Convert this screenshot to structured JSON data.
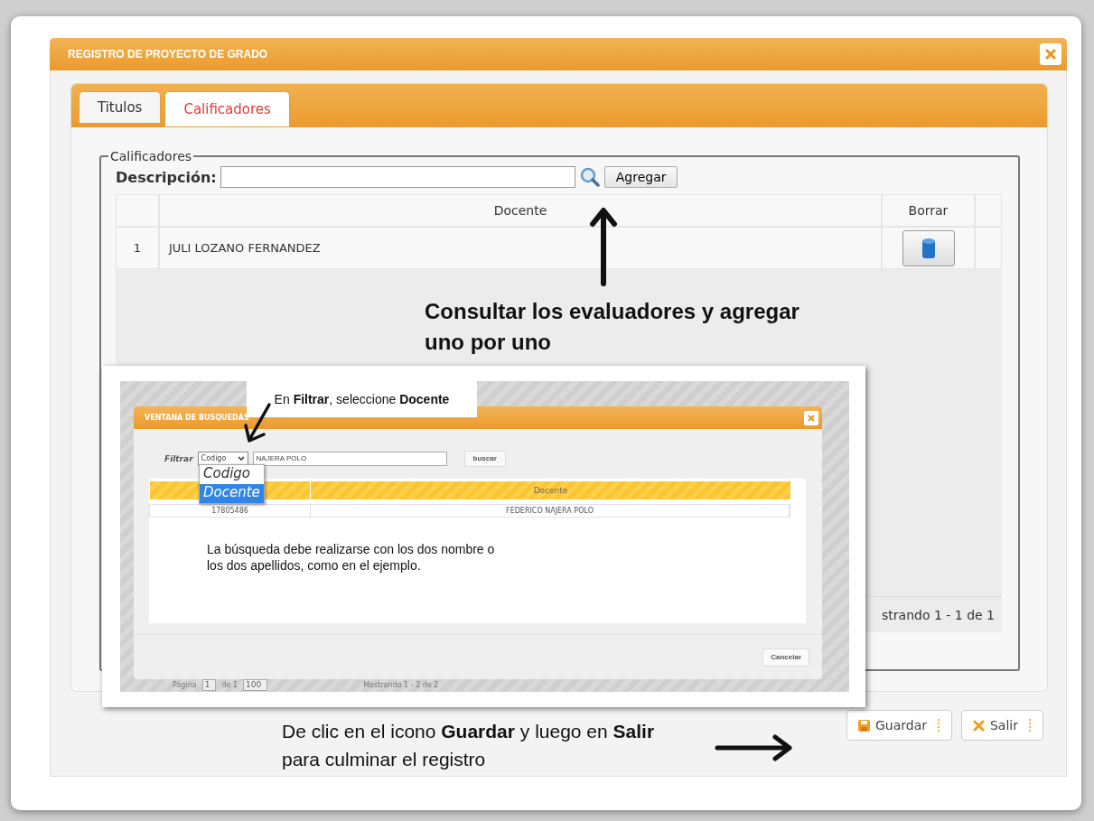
{
  "dialog": {
    "title": "REGISTRO DE PROYECTO DE GRADO"
  },
  "tabs": [
    {
      "label": "Titulos",
      "selected": false
    },
    {
      "label": "Calificadores",
      "selected": true
    }
  ],
  "fieldset": {
    "legend": "Calificadores",
    "search_label": "Descripción:",
    "add_button": "Agregar",
    "columns": [
      "Docente",
      "Borrar"
    ],
    "rows": [
      {
        "index": "1",
        "docente": "JULI LOZANO FERNANDEZ"
      }
    ],
    "pager": "strando 1 - 1 de 1"
  },
  "buttons": [
    {
      "kind": "save",
      "label": "Guardar"
    },
    {
      "kind": "exit",
      "label": "Salir"
    }
  ],
  "annotations": {
    "search": "Consultar los evaluadores y agregar uno por uno",
    "callout": "En **Filtrar**, seleccione **Docente**",
    "note": "La búsqueda debe realizarse con los dos nombre o los dos apellidos, como en el ejemplo.",
    "footer": "De clic en el icono **Guardar** y luego en **Salir** para culminar el registro"
  },
  "inset": {
    "title": "VENTANA DE BUSQUEDAS",
    "filter_label": "Filtrar",
    "filter_value": "Codigo",
    "search_value": "NAJERA POLO",
    "search_button": "buscar",
    "options": [
      {
        "label": "Codigo",
        "selected": false
      },
      {
        "label": "Docente",
        "selected": true
      }
    ],
    "columns": [
      "Docente"
    ],
    "rows": [
      {
        "codigo": "17805486",
        "docente": "FEDERICO NAJERA POLO"
      }
    ],
    "cancel": "Cancelar",
    "pager": {
      "page_label": "Página",
      "page": "1",
      "of": "de 1",
      "size": "100",
      "summary": "Mostrando 1 - 2 de 2"
    }
  }
}
